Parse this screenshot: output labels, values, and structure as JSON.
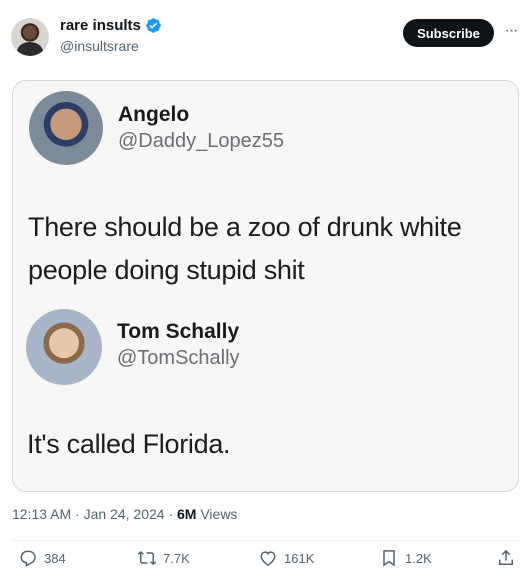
{
  "post": {
    "author": {
      "name": "rare insults",
      "handle": "@insultsrare",
      "verified": true
    },
    "subscribe_label": "Subscribe",
    "more_label": "···",
    "timestamp": "12:13 AM · Jan 24, 2024 · ",
    "views_count": "6M",
    "views_label": " Views"
  },
  "quote_image": {
    "tweet1": {
      "name": "Angelo",
      "handle": "@Daddy_Lopez55",
      "text_line1": "There should be a zoo of drunk white",
      "text_line2": "people doing stupid shit"
    },
    "tweet2": {
      "name": "Tom Schally",
      "handle": "@TomSchally",
      "text": "It's called Florida."
    }
  },
  "actions": {
    "replies": "384",
    "reposts": "7.7K",
    "likes": "161K",
    "bookmarks": "1.2K"
  },
  "colors": {
    "accent": "#1d9bf0",
    "text": "#0f1419",
    "muted": "#536471"
  }
}
